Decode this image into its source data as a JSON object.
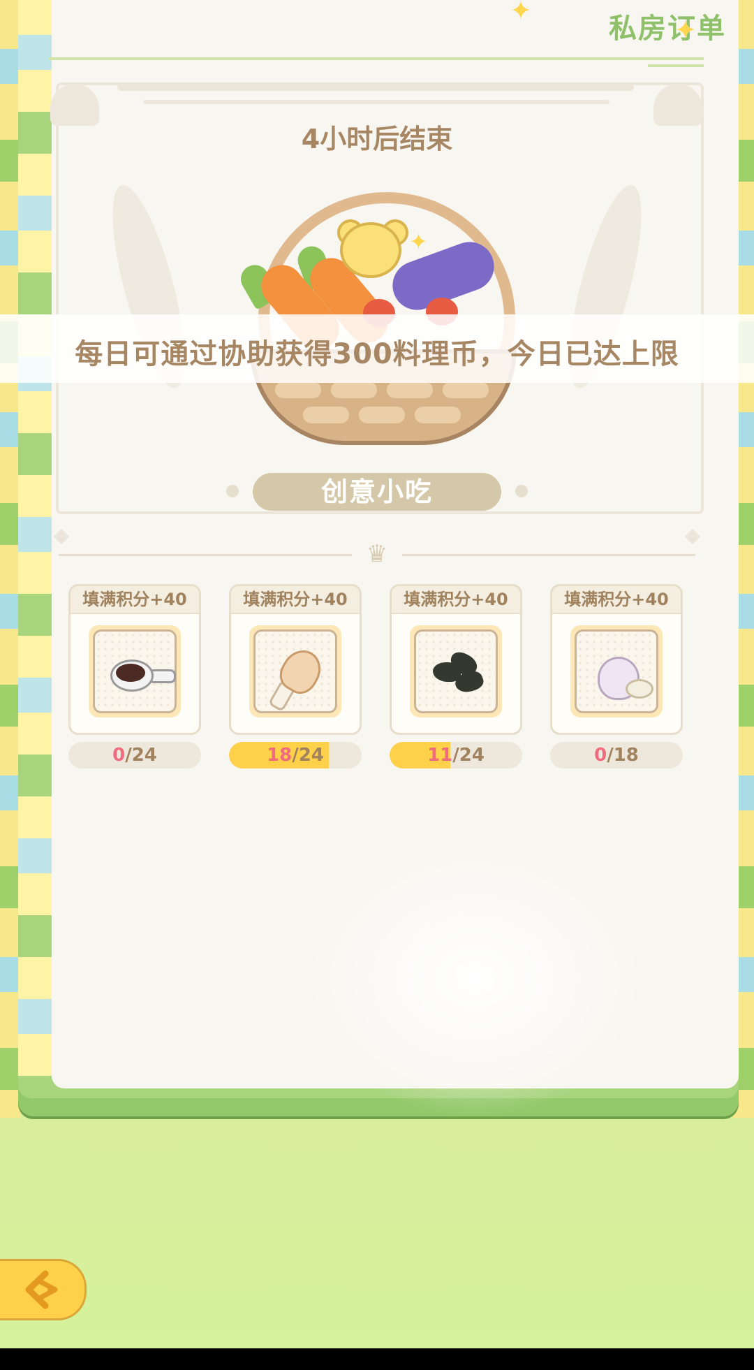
{
  "header": {
    "title": "私房订单"
  },
  "order": {
    "countdown": "4小时后结束",
    "notice": "每日可通过协助获得300料理币，今日已达上限",
    "category": "创意小吃"
  },
  "ingredients": [
    {
      "icon": "sauce-dish-icon",
      "label": "填满积分+40",
      "current": "0",
      "total": "/24",
      "progress": 0.0
    },
    {
      "icon": "chicken-drumstick-icon",
      "label": "填满积分+40",
      "current": "18",
      "total": "/24",
      "progress": 0.75
    },
    {
      "icon": "black-fungus-icon",
      "label": "填满积分+40",
      "current": "11",
      "total": "/24",
      "progress": 0.458
    },
    {
      "icon": "garlic-icon",
      "label": "填满积分+40",
      "current": "0",
      "total": "/18",
      "progress": 0.0
    }
  ],
  "colors": {
    "accent_green": "#8fc06a",
    "progress_fill": "#ffd14a",
    "current_count": "#f06b7e",
    "text_brown": "#a68663"
  },
  "footer": {
    "back_icon": "back-arrow-icon"
  }
}
